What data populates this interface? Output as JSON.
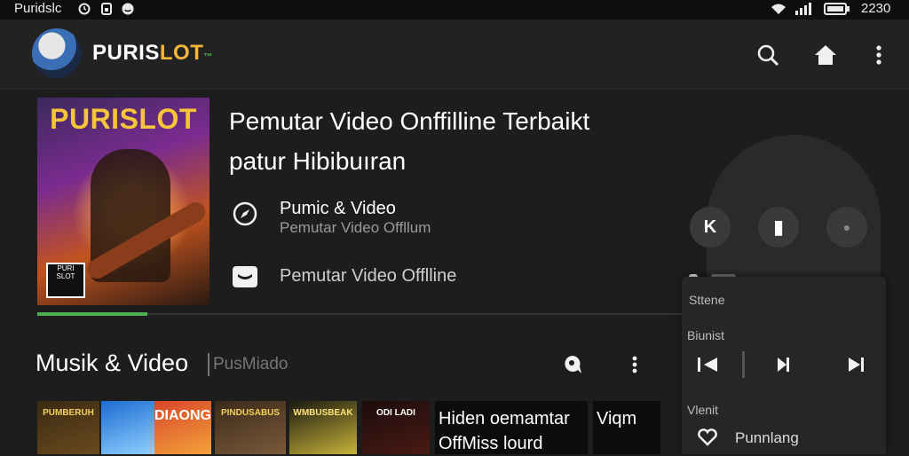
{
  "status_bar": {
    "app_name": "Puridslc",
    "time": "2230",
    "icons": [
      "alarm-icon",
      "sim-icon",
      "face-icon",
      "wifi-icon",
      "signal-icon",
      "battery-icon"
    ]
  },
  "app_bar": {
    "brand_prefix": "PURIS",
    "brand_suffix": "LOT",
    "brand_tag": "™",
    "actions": [
      "search-icon",
      "home-icon",
      "more-vert-icon"
    ]
  },
  "hero": {
    "cover_title": "PURISLOT",
    "cover_stamp": "PURI SLOT",
    "title_line1": "Pemutar Video Onffilline Terbaikt",
    "title_line2": "patur Hibibuıran",
    "rows": [
      {
        "icon": "compass-icon",
        "title": "Pumic & Video",
        "subtitle": "Pemutar Video Offllum"
      },
      {
        "icon": "offline-badge-icon",
        "title": "Pemutar Video Offlline",
        "subtitle": ""
      }
    ],
    "progress": 0.17
  },
  "section": {
    "title": "Musik & Video",
    "search_placeholder": "PusMiado",
    "actions": [
      "tag-icon",
      "more-vert-icon"
    ]
  },
  "thumbnails": [
    {
      "label": "PUMBERUH",
      "colors": [
        "#3a2a12",
        "#6a4a1f"
      ]
    },
    {
      "label": "",
      "colors": [
        "#1d6bd1",
        "#8fd0ff"
      ]
    },
    {
      "label": "DIAONG",
      "colors": [
        "#d8462a",
        "#f3a23a"
      ]
    },
    {
      "label": "PINDUSABUS",
      "colors": [
        "#3b2a1a",
        "#7a5a3a"
      ]
    },
    {
      "label": "WMBUSBEAK",
      "colors": [
        "#1a1a10",
        "#c8b23a"
      ]
    },
    {
      "label": "ODI LADI",
      "colors": [
        "#1b0c0c",
        "#4a1a14"
      ]
    }
  ],
  "tiles": [
    {
      "line1": "Hiden  oemamtar",
      "line2": "OffMiss lourd"
    },
    {
      "line1": "Viqm",
      "line2": ""
    }
  ],
  "player": {
    "top_controls": [
      "K",
      "▮",
      "●"
    ],
    "label_status": "Sttene",
    "label_playlist": "Biunist",
    "label_variant": "Vlenit",
    "fav_label": "Punnlang",
    "accent": "#4caf50"
  }
}
